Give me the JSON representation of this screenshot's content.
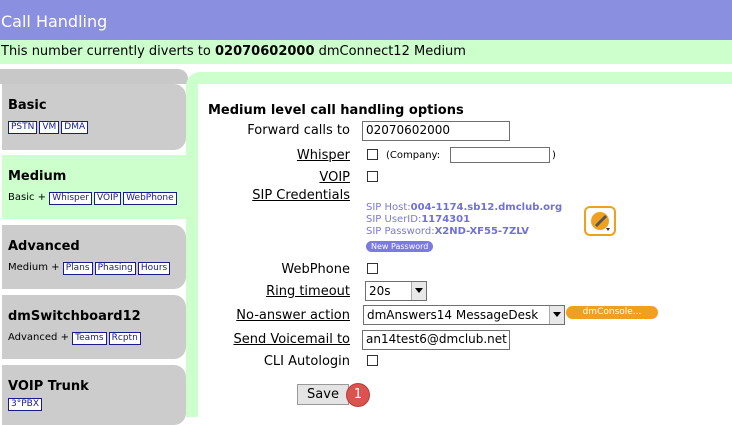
{
  "title": "Call Handling",
  "divert": {
    "prefix": "This number currently diverts to",
    "number": "02070602000",
    "suffix": "dmConnect12 Medium"
  },
  "sidebar": {
    "tabs": [
      {
        "title": "Basic",
        "prefix": "",
        "chips": [
          "PSTN",
          "VM",
          "DMA"
        ]
      },
      {
        "title": "Medium",
        "prefix": "Basic +",
        "chips": [
          "Whisper",
          "VOIP",
          "WebPhone"
        ]
      },
      {
        "title": "Advanced",
        "prefix": "Medium +",
        "chips": [
          "Plans",
          "Phasing",
          "Hours"
        ]
      },
      {
        "title": "dmSwitchboard12",
        "prefix": "Advanced +",
        "chips": [
          "Teams",
          "Rcptn"
        ]
      },
      {
        "title": "VOIP Trunk",
        "prefix": "",
        "chips": [
          "3°PBX"
        ]
      }
    ]
  },
  "form": {
    "heading": "Medium level call handling options",
    "forward_label": "Forward calls to",
    "forward_value": "02070602000",
    "whisper_label": "Whisper",
    "company_open": "(Company:",
    "company_close": ")",
    "company_value": "",
    "voip_label": "VOIP",
    "sip_label": "SIP Credentials",
    "sip_host_label": "SIP Host:",
    "sip_host": "004-1174.sb12.dmclub.org",
    "sip_user_label": "SIP UserID:",
    "sip_user": "1174301",
    "sip_pass_label": "SIP Password:",
    "sip_pass": "X2ND-XF55-7ZLV",
    "new_password": "New Password",
    "webphone_label": "WebPhone",
    "ring_label": "Ring timeout",
    "ring_value": "20s",
    "noanswer_label": "No-answer action",
    "noanswer_value": "dmAnswers14 MessageDesk",
    "dmconsole": "dmConsole...",
    "voicemail_label": "Send Voicemail to",
    "voicemail_value": "an14test6@dmclub.net",
    "cli_label": "CLI Autologin",
    "save": "Save",
    "badge": "1"
  },
  "colors": {
    "title_bar": "#8a8fe0",
    "divert_bar": "#ccffcc",
    "accent_orange": "#f0a020"
  }
}
